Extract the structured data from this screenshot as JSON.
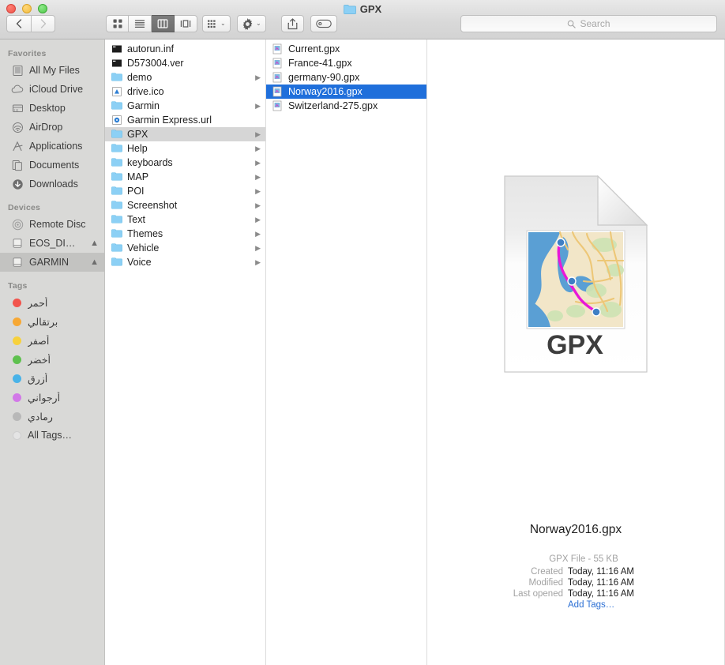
{
  "window": {
    "title": "GPX",
    "folder_icon": "folder-icon",
    "traffic_lights": [
      "close",
      "minimize",
      "zoom"
    ]
  },
  "toolbar": {
    "back_label": "‹",
    "forward_label": "›",
    "view_icon_label": "icon-view",
    "view_list_label": "list-view",
    "view_column_label": "column-view",
    "view_coverflow_label": "coverflow-view",
    "arrange_label": "arrange",
    "action_label": "action",
    "share_label": "share",
    "tag_label": "tag",
    "chevron": "⌄"
  },
  "search": {
    "placeholder": "Search",
    "icon": "search-icon"
  },
  "sidebar": {
    "sections": [
      {
        "header": "Favorites",
        "items": [
          {
            "label": "All My Files",
            "icon": "all-my-files-icon"
          },
          {
            "label": "iCloud Drive",
            "icon": "icloud-icon"
          },
          {
            "label": "Desktop",
            "icon": "desktop-icon"
          },
          {
            "label": "AirDrop",
            "icon": "airdrop-icon"
          },
          {
            "label": "Applications",
            "icon": "applications-icon"
          },
          {
            "label": "Documents",
            "icon": "documents-icon"
          },
          {
            "label": "Downloads",
            "icon": "downloads-icon"
          }
        ]
      },
      {
        "header": "Devices",
        "items": [
          {
            "label": "Remote Disc",
            "icon": "remote-disc-icon",
            "eject": false,
            "selected": false
          },
          {
            "label": "EOS_DI…",
            "icon": "drive-icon",
            "eject": true,
            "selected": false
          },
          {
            "label": "GARMIN",
            "icon": "drive-icon",
            "eject": true,
            "selected": true
          }
        ]
      }
    ],
    "tags_header": "Tags",
    "tags": [
      {
        "label": "أحمر",
        "color": "#f2544c",
        "rtl": true
      },
      {
        "label": "برتقالي",
        "color": "#f7a834",
        "rtl": true
      },
      {
        "label": "أصفر",
        "color": "#f7d13c",
        "rtl": true
      },
      {
        "label": "أخضر",
        "color": "#5ec14e",
        "rtl": true
      },
      {
        "label": "أزرق",
        "color": "#49b3e8",
        "rtl": true
      },
      {
        "label": "أرجواني",
        "color": "#d278e8",
        "rtl": true
      },
      {
        "label": "رمادي",
        "color": "#b8b8b8",
        "rtl": true
      },
      {
        "label": "All Tags…",
        "color": "#e4e4e4",
        "rtl": false
      }
    ]
  },
  "column1": {
    "items": [
      {
        "name": "autorun.inf",
        "icon": "inf-file-icon",
        "folder": false,
        "selected": false
      },
      {
        "name": "D573004.ver",
        "icon": "ver-file-icon",
        "folder": false,
        "selected": false
      },
      {
        "name": "demo",
        "icon": "folder-icon",
        "folder": true,
        "selected": false
      },
      {
        "name": "drive.ico",
        "icon": "ico-file-icon",
        "folder": false,
        "selected": false
      },
      {
        "name": "Garmin",
        "icon": "folder-icon",
        "folder": true,
        "selected": false
      },
      {
        "name": "Garmin Express.url",
        "icon": "url-file-icon",
        "folder": false,
        "selected": false
      },
      {
        "name": "GPX",
        "icon": "folder-icon",
        "folder": true,
        "selected": true
      },
      {
        "name": "Help",
        "icon": "folder-icon",
        "folder": true,
        "selected": false
      },
      {
        "name": "keyboards",
        "icon": "folder-icon",
        "folder": true,
        "selected": false
      },
      {
        "name": "MAP",
        "icon": "folder-icon",
        "folder": true,
        "selected": false
      },
      {
        "name": "POI",
        "icon": "folder-icon",
        "folder": true,
        "selected": false
      },
      {
        "name": "Screenshot",
        "icon": "folder-icon",
        "folder": true,
        "selected": false
      },
      {
        "name": "Text",
        "icon": "folder-icon",
        "folder": true,
        "selected": false
      },
      {
        "name": "Themes",
        "icon": "folder-icon",
        "folder": true,
        "selected": false
      },
      {
        "name": "Vehicle",
        "icon": "folder-icon",
        "folder": true,
        "selected": false
      },
      {
        "name": "Voice",
        "icon": "folder-icon",
        "folder": true,
        "selected": false
      }
    ]
  },
  "column2": {
    "items": [
      {
        "name": "Current.gpx",
        "icon": "gpx-file-icon",
        "selected": false
      },
      {
        "name": "France-41.gpx",
        "icon": "gpx-file-icon",
        "selected": false
      },
      {
        "name": "germany-90.gpx",
        "icon": "gpx-file-icon",
        "selected": false
      },
      {
        "name": "Norway2016.gpx",
        "icon": "gpx-file-icon",
        "selected": true
      },
      {
        "name": "Switzerland-275.gpx",
        "icon": "gpx-file-icon",
        "selected": false
      }
    ]
  },
  "preview": {
    "icon_label": "GPX",
    "filename": "Norway2016.gpx",
    "kind_and_size": "GPX File - 55 KB",
    "created_label": "Created",
    "created_value": "Today, 11:16 AM",
    "modified_label": "Modified",
    "modified_value": "Today, 11:16 AM",
    "last_opened_label": "Last opened",
    "last_opened_value": "Today, 11:16 AM",
    "add_tags": "Add Tags…"
  },
  "colors": {
    "selection_blue": "#1f6fdb",
    "sidebar_bg": "#d9d9d7",
    "link_blue": "#2b6fd4",
    "map_water": "#5a9fd4",
    "map_land": "#f2e6c8",
    "map_route": "#e818d8"
  }
}
